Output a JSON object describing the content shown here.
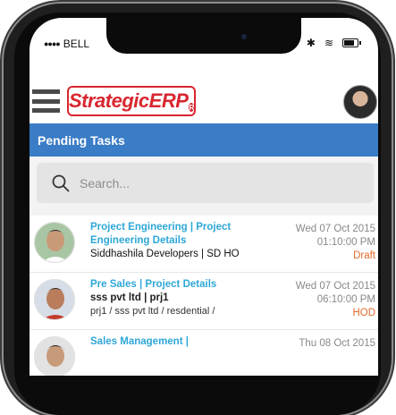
{
  "status_bar": {
    "signal": "●●●●",
    "carrier": "BELL",
    "bluetooth": "✱",
    "wifi": "≋"
  },
  "header": {
    "logo_text": "StrategicERP",
    "logo_reg": "R"
  },
  "titlebar": {
    "title": "Pending Tasks"
  },
  "search": {
    "placeholder": "Search..."
  },
  "tasks": [
    {
      "title_line1": "Project Engineering | Project",
      "title_line2": "Engineering Details",
      "sub": "Siddhashila Developers | SD HO",
      "detail": "",
      "date": "Wed 07 Oct 2015",
      "time": "01:10:00 PM",
      "status": "Draft",
      "status_color": "#e2692a"
    },
    {
      "title_line1": "Pre Sales | Project Details",
      "title_line2": "",
      "sub": "sss pvt ltd | prj1",
      "detail": "prj1 / sss pvt ltd / resdential /",
      "date": "Wed 07 Oct 2015",
      "time": "06:10:00 PM",
      "status": "HOD",
      "status_color": "#e2692a"
    },
    {
      "title_line1": "Sales Management |",
      "title_line2": "",
      "sub": "",
      "detail": "",
      "date": "Thu 08 Oct 2015",
      "time": "",
      "status": "",
      "status_color": "#e2692a"
    }
  ],
  "colors": {
    "brand_red": "#d8262f",
    "header_blue": "#3b7cc6",
    "link_blue": "#2ea7d7"
  }
}
